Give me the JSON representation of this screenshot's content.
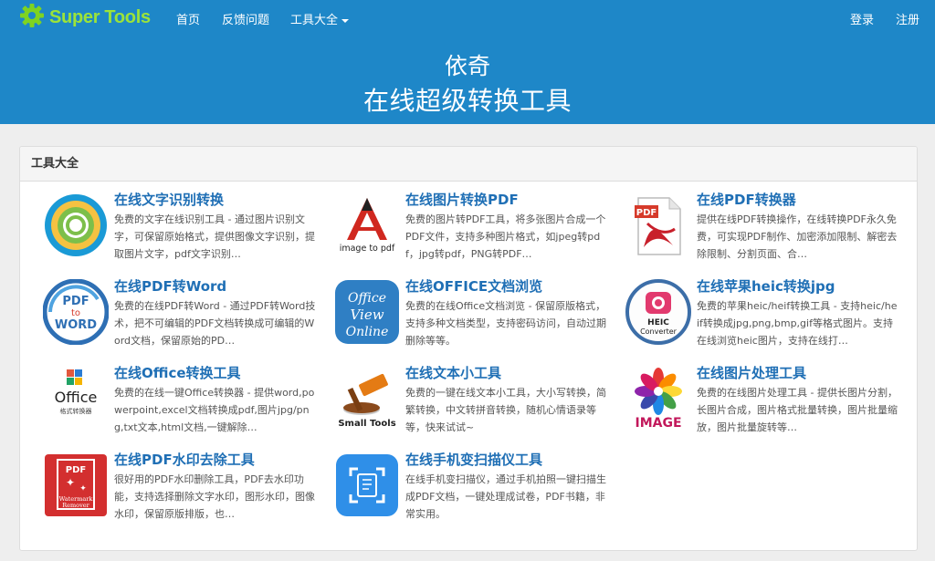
{
  "brand": {
    "name": "Super Tools"
  },
  "nav": {
    "home": "首页",
    "feedback": "反馈问题",
    "tools": "工具大全",
    "login": "登录",
    "register": "注册"
  },
  "hero": {
    "name": "依奇",
    "title": "在线超级转换工具"
  },
  "panel": {
    "heading": "工具大全",
    "tools": [
      {
        "title": "在线文字识别转换",
        "desc": "免费的文字在线识别工具 - 通过图片识别文字，可保留原始格式，提供图像文字识别，提取图片文字，pdf文字识别…",
        "icon": "ocr-ring-icon"
      },
      {
        "title": "在线图片转换PDF",
        "desc": "免费的图片转PDF工具，将多张图片合成一个PDF文件，支持多种图片格式，如jpeg转pdf，jpg转pdf，PNG转PDF…",
        "icon": "image-to-pdf-icon",
        "icon_text": "image to pdf"
      },
      {
        "title": "在线PDF转换器",
        "desc": "提供在线PDF转换操作，在线转换PDF永久免费，可实现PDF制作、加密添加限制、解密去除限制、分割页面、合…",
        "icon": "pdf-document-icon",
        "icon_text": "PDF"
      },
      {
        "title": "在线PDF转Word",
        "desc": "免费的在线PDF转Word - 通过PDF转Word技术，把不可编辑的PDF文档转换成可编辑的Word文档，保留原始的PD…",
        "icon": "pdf-to-word-icon",
        "icon_text": [
          "PDF",
          "to",
          "WORD"
        ]
      },
      {
        "title": "在线OFFICE文档浏览",
        "desc": "免费的在线Office文档浏览 - 保留原版格式，支持多种文档类型，支持密码访问，自动过期删除等等。",
        "icon": "office-view-online-icon",
        "icon_text": [
          "Office",
          "View",
          "Online"
        ]
      },
      {
        "title": "在线苹果heic转换jpg",
        "desc": "免费的苹果heic/heif转换工具 - 支持heic/heif转换成jpg,png,bmp,gif等格式图片。支持在线浏览heic图片，支持在线打…",
        "icon": "heic-converter-icon",
        "icon_text": [
          "HEIC",
          "Converter"
        ]
      },
      {
        "title": "在线Office转换工具",
        "desc": "免费的在线一键Office转换器 - 提供word,powerpoint,excel文档转换成pdf,图片jpg/png,txt文本,html文档,一键解除…",
        "icon": "office-converter-icon",
        "icon_text": [
          "Office",
          "格式转换器"
        ]
      },
      {
        "title": "在线文本小工具",
        "desc": "免费的一键在线文本小工具，大小写转换，简繁转换，中文转拼音转换，随机心情语录等等，快来试试~",
        "icon": "small-tools-hammer-icon",
        "icon_text": "Small Tools"
      },
      {
        "title": "在线图片处理工具",
        "desc": "免费的在线图片处理工具 - 提供长图片分割，长图片合成，图片格式批量转换，图片批量缩放，图片批量旋转等…",
        "icon": "image-flower-icon",
        "icon_text": "IMAGE"
      },
      {
        "title": "在线PDF水印去除工具",
        "desc": "很好用的PDF水印删除工具，PDF去水印功能，支持选择删除文字水印，图形水印，图像水印，保留原版排版，也…",
        "icon": "watermark-remover-icon",
        "icon_text": [
          "PDF",
          "Watermark",
          "Remover"
        ]
      },
      {
        "title": "在线手机变扫描仪工具",
        "desc": "在线手机变扫描仪，通过手机拍照一键扫描生成PDF文档，一键处理成试卷，PDF书籍，非常实用。",
        "icon": "scanner-icon"
      }
    ]
  },
  "colors": {
    "brand_blue": "#1e87c8",
    "logo_green": "#9be33a",
    "link_blue": "#1f6fb5"
  }
}
